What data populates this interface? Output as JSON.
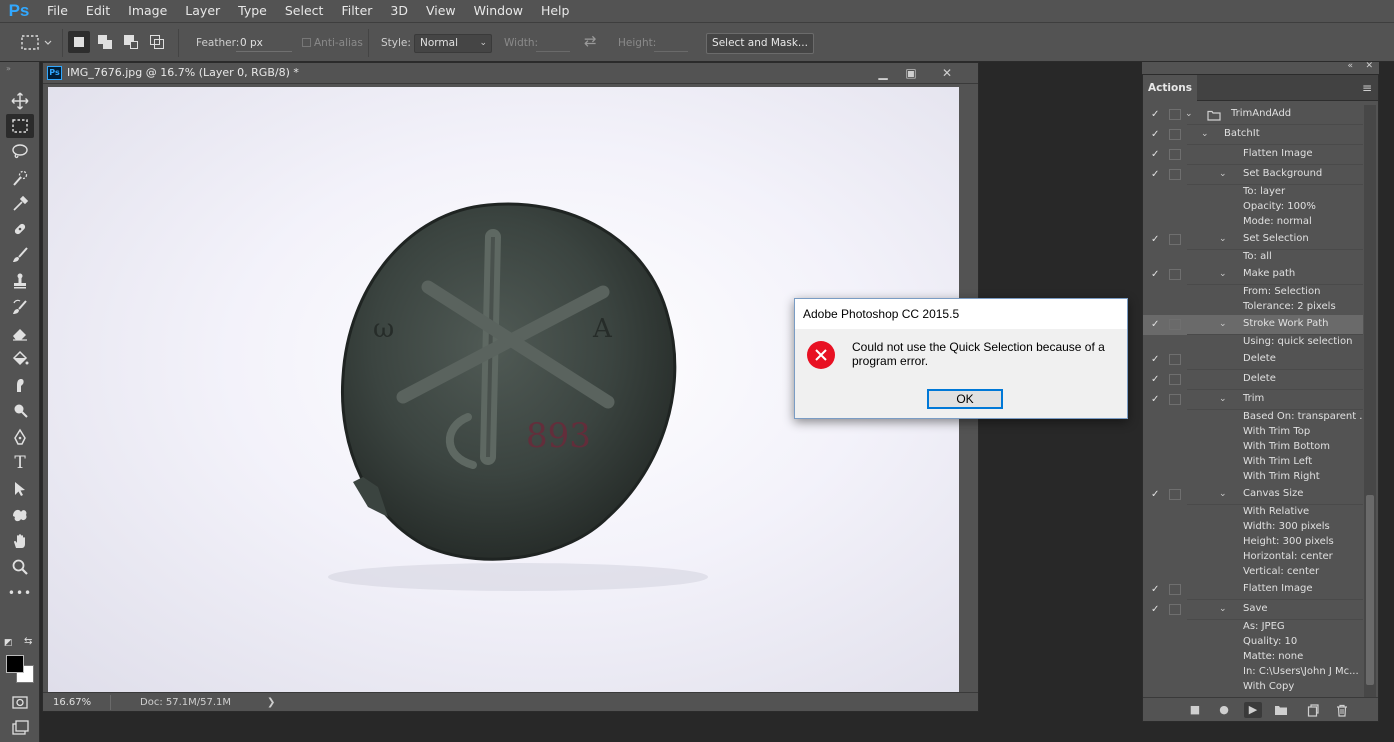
{
  "app": {
    "logo": "Ps"
  },
  "menu": [
    "File",
    "Edit",
    "Image",
    "Layer",
    "Type",
    "Select",
    "Filter",
    "3D",
    "View",
    "Window",
    "Help"
  ],
  "options": {
    "feather_label": "Feather:",
    "feather_value": "0 px",
    "antialias_label": "Anti-alias",
    "style_label": "Style:",
    "style_value": "Normal",
    "width_label": "Width:",
    "height_label": "Height:",
    "select_mask_label": "Select and Mask..."
  },
  "document": {
    "title": "IMG_7676.jpg @ 16.7% (Layer 0, RGB/8) *",
    "zoom": "16.67%",
    "doc_size": "Doc: 57.1M/57.1M",
    "status_arrow": "❯",
    "image_label": "893"
  },
  "dialog": {
    "title": "Adobe Photoshop CC 2015.5",
    "message": "Could not use the Quick Selection because of a program error.",
    "ok_label": "OK"
  },
  "panel": {
    "tab_label": "Actions",
    "menu_icon": "≡",
    "rows": [
      {
        "label": "TrimAndAdd",
        "check": true,
        "dlg": true,
        "twirl": true,
        "folder": true,
        "level": 0
      },
      {
        "label": "BatchIt",
        "check": true,
        "dlg": true,
        "twirl": true,
        "level": 1
      },
      {
        "label": "Flatten Image",
        "check": true,
        "dlg": true,
        "level": 2
      },
      {
        "label": "Set Background",
        "check": true,
        "dlg": true,
        "twirl": true,
        "level": 2
      },
      {
        "label": "To: layer",
        "level": 3
      },
      {
        "label": "Opacity: 100%",
        "level": 3
      },
      {
        "label": "Mode: normal",
        "level": 3
      },
      {
        "label": "Set Selection",
        "check": true,
        "dlg": true,
        "twirl": true,
        "level": 2
      },
      {
        "label": "To: all",
        "level": 3
      },
      {
        "label": "Make path",
        "check": true,
        "dlg": true,
        "twirl": true,
        "level": 2
      },
      {
        "label": "From: Selection",
        "level": 3
      },
      {
        "label": "Tolerance: 2 pixels",
        "level": 3
      },
      {
        "label": "Stroke Work Path",
        "check": true,
        "dlg": true,
        "twirl": true,
        "level": 2,
        "highlight": true
      },
      {
        "label": "Using: quick selection",
        "level": 3
      },
      {
        "label": "Delete",
        "check": true,
        "dlg": true,
        "level": 2
      },
      {
        "label": "Delete",
        "check": true,
        "dlg": true,
        "level": 2
      },
      {
        "label": "Trim",
        "check": true,
        "dlg": true,
        "twirl": true,
        "level": 2
      },
      {
        "label": "Based On: transparent ...",
        "level": 3
      },
      {
        "label": "With Trim Top",
        "level": 3
      },
      {
        "label": "With Trim Bottom",
        "level": 3
      },
      {
        "label": "With Trim Left",
        "level": 3
      },
      {
        "label": "With Trim Right",
        "level": 3
      },
      {
        "label": "Canvas Size",
        "check": true,
        "dlg": true,
        "twirl": true,
        "level": 2
      },
      {
        "label": "With Relative",
        "level": 3
      },
      {
        "label": "Width: 300 pixels",
        "level": 3
      },
      {
        "label": "Height: 300 pixels",
        "level": 3
      },
      {
        "label": "Horizontal: center",
        "level": 3
      },
      {
        "label": "Vertical: center",
        "level": 3
      },
      {
        "label": "Flatten Image",
        "check": true,
        "dlg": true,
        "level": 2
      },
      {
        "label": "Save",
        "check": true,
        "dlg": true,
        "twirl": true,
        "level": 2
      },
      {
        "label": "As: JPEG",
        "level": 3
      },
      {
        "label": "Quality: 10",
        "level": 3
      },
      {
        "label": "Matte: none",
        "level": 3
      },
      {
        "label": "In: C:\\Users\\John J Mc...",
        "level": 3
      },
      {
        "label": "With Copy",
        "level": 3
      }
    ]
  },
  "icons": {
    "move": "move-icon",
    "marquee": "rect-marquee-icon",
    "lasso": "lasso-icon",
    "quick_select": "quick-selection-icon",
    "eyedropper": "eyedropper-icon",
    "heal": "healing-brush-icon",
    "brush": "brush-icon",
    "stamp": "clone-stamp-icon",
    "history": "history-brush-icon",
    "eraser": "eraser-icon",
    "bucket": "paint-bucket-icon",
    "smudge": "smudge-icon",
    "dodge": "dodge-icon",
    "pen": "pen-icon",
    "type": "type-icon",
    "path_select": "path-selection-icon",
    "shape": "custom-shape-icon",
    "hand": "hand-icon",
    "zoom": "zoom-icon",
    "more": "more-icon"
  },
  "colors": {
    "accent": "#31a8ff",
    "error": "#e81123",
    "foreground": "#000000",
    "background": "#ffffff"
  }
}
